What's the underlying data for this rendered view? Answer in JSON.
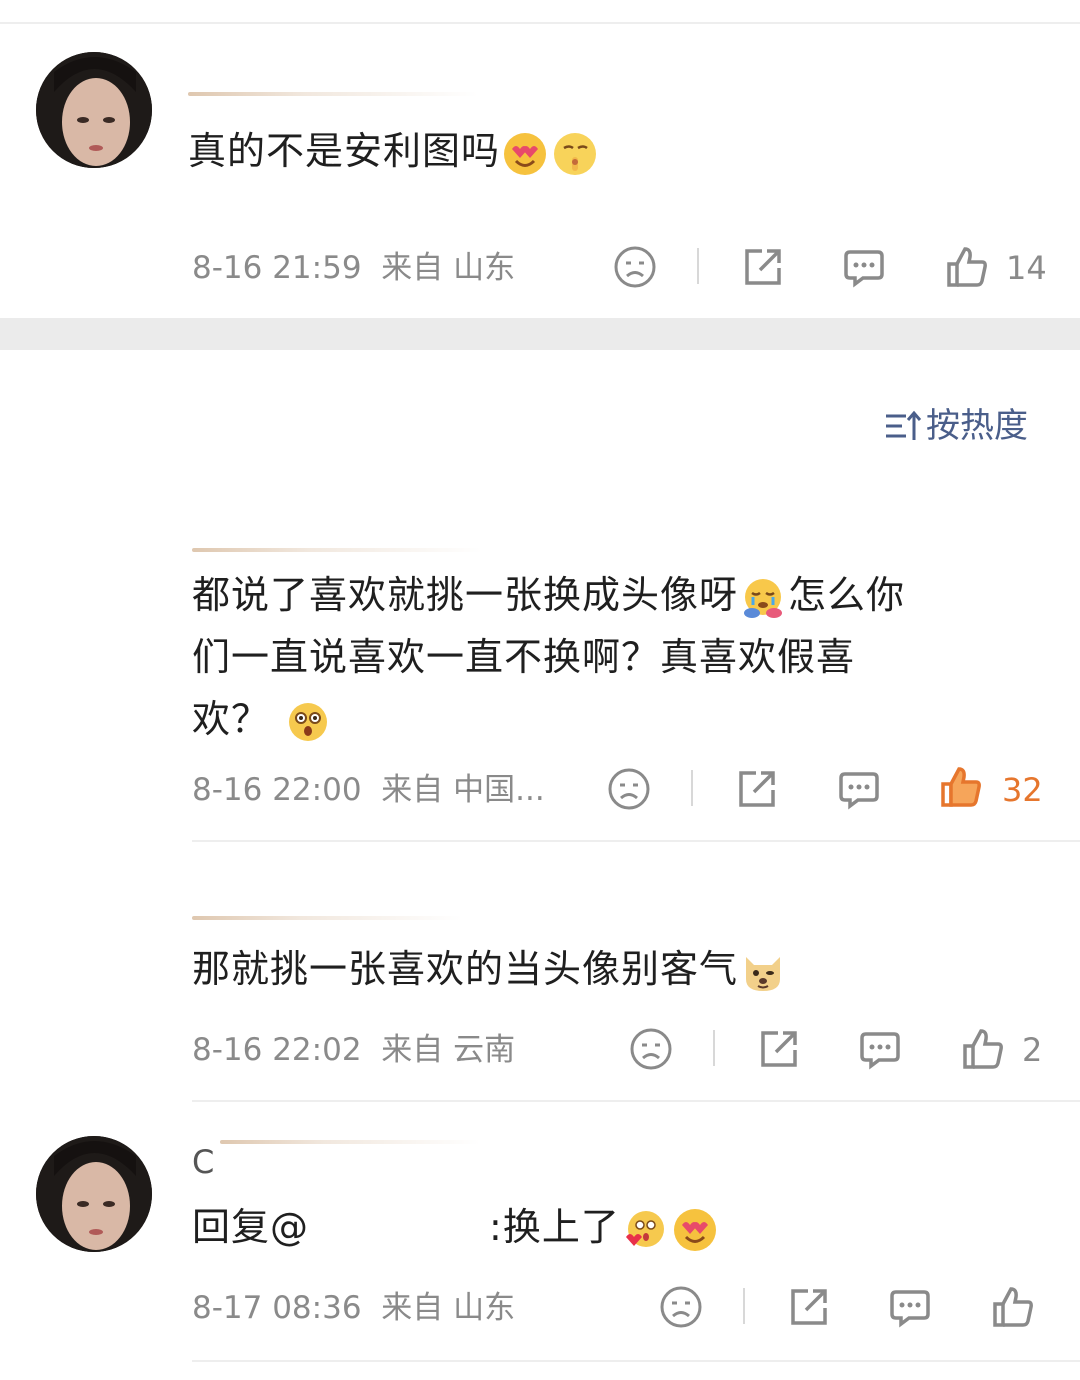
{
  "comment1": {
    "text": "真的不是安利图吗",
    "emojis": [
      "heart-eyes-emoji",
      "shush-emoji"
    ],
    "time": "8-16 21:59",
    "from_label": "来自",
    "location": "山东",
    "likes": "14"
  },
  "sort": {
    "icon": "sort-icon",
    "label": "按热度"
  },
  "comment2": {
    "line1": "都说了喜欢就挑一张换成头像呀",
    "line1b": "怎么你",
    "line2": "们一直说喜欢一直不换啊？真喜欢假喜",
    "line3": "欢？",
    "emojis": [
      "crying-hug-emoji",
      "shocked-emoji"
    ],
    "time": "8-16 22:00",
    "from_label": "来自",
    "location": "中国...",
    "likes": "32",
    "liked_color": "#e6762d"
  },
  "comment3": {
    "text": "那就挑一张喜欢的当头像别客气",
    "emojis": [
      "doge-emoji"
    ],
    "time": "8-16 22:02",
    "from_label": "来自",
    "location": "云南",
    "likes": "2"
  },
  "comment4": {
    "name_partial": "C",
    "reply_prefix": "回复@",
    "reply_suffix": ":换上了",
    "emojis": [
      "kiss-emoji",
      "heart-eyes-emoji"
    ],
    "time": "8-17 08:36",
    "from_label": "来自",
    "location": "山东"
  }
}
